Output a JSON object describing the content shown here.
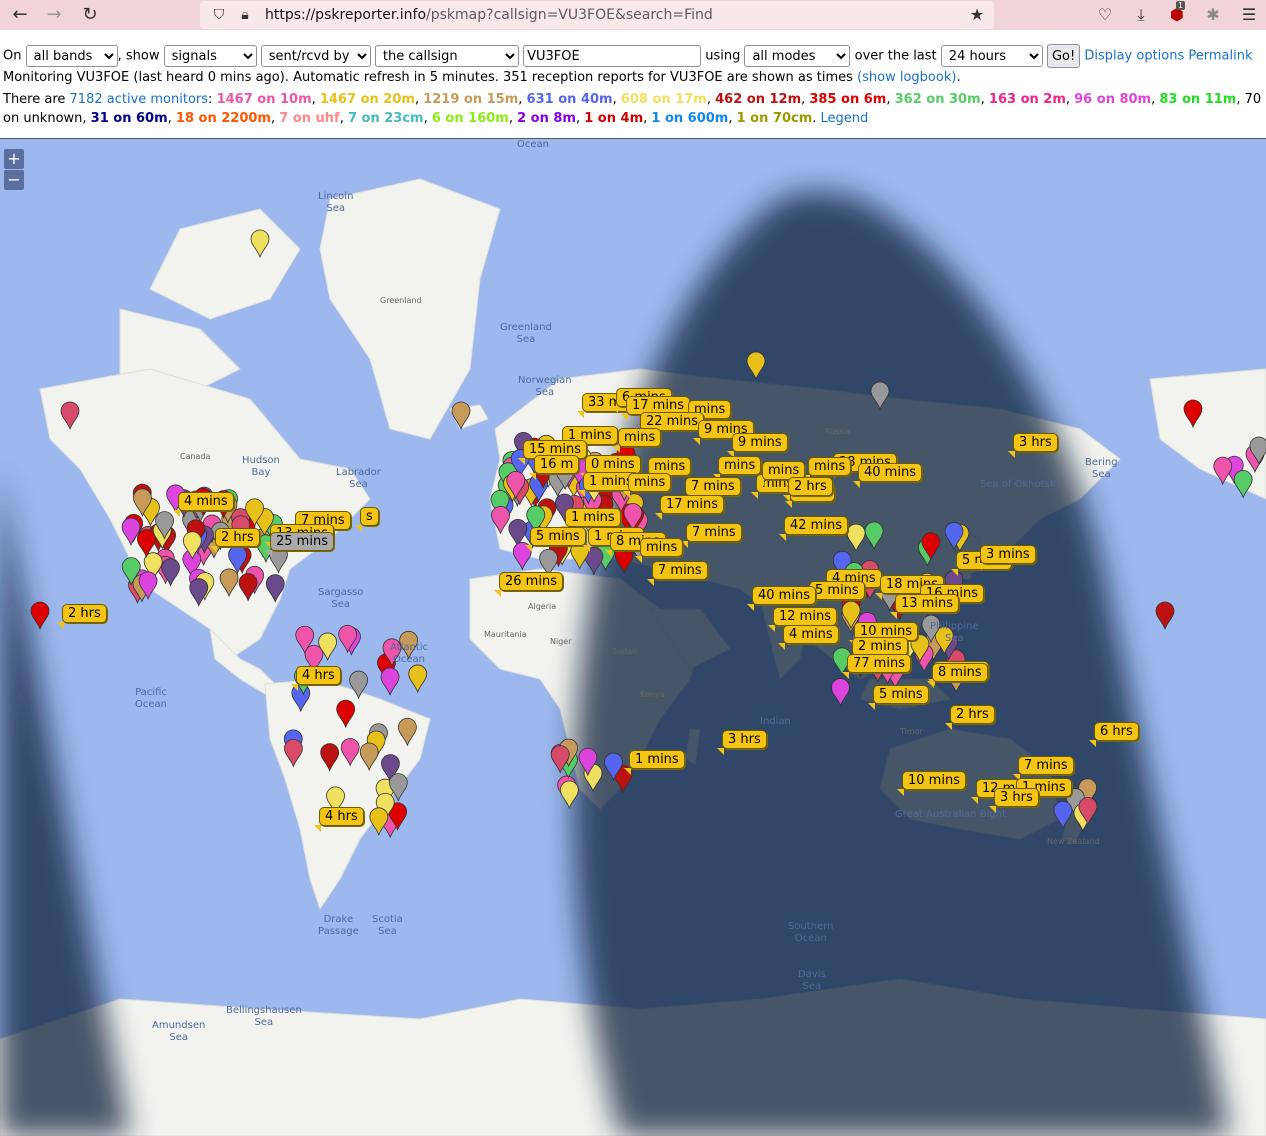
{
  "browser": {
    "url_domain": "https://pskreporter.info",
    "url_path": "/pskmap?callsign=VU3FOE&search=Find",
    "badge_count": "1"
  },
  "controls": {
    "on_label": "On",
    "band_select": "all bands",
    "show_label": ", show",
    "show_select": "signals",
    "direction_select": "sent/rcvd by",
    "target_select": "the callsign",
    "callsign_value": "VU3FOE",
    "using_label": "using",
    "mode_select": "all modes",
    "over_label": "over the last",
    "period_select": "24 hours",
    "go_button": "Go!",
    "display_options_link": "Display options",
    "permalink_link": "Permalink"
  },
  "status": {
    "monitoring_text": "Monitoring VU3FOE (last heard 0 mins ago). Automatic refresh in 5 minutes. 351 reception reports for VU3FOE are shown as times ",
    "logbook_link": "(show logbook)",
    "logbook_suffix": "."
  },
  "monitors": {
    "prefix": "There are ",
    "active_link": "7182 active monitors",
    "colon": ":",
    "bands": [
      {
        "text": "1467 on 10m",
        "color": "#ee55aa"
      },
      {
        "text": "1467 on 20m",
        "color": "#e8c01a"
      },
      {
        "text": "1219 on 15m",
        "color": "#c89a5a"
      },
      {
        "text": "631 on 40m",
        "color": "#5566ee"
      },
      {
        "text": "608 on 17m",
        "color": "#f0e060"
      },
      {
        "text": "462 on 12m",
        "color": "#bb1111"
      },
      {
        "text": "385 on 6m",
        "color": "#dd0000"
      },
      {
        "text": "362 on 30m",
        "color": "#55cc66"
      },
      {
        "text": "163 on 2m",
        "color": "#ee2288"
      },
      {
        "text": "96 on 80m",
        "color": "#dd44dd"
      },
      {
        "text": "83 on 11m",
        "color": "#22dd22"
      },
      {
        "text": "70 on unknown",
        "color": "#000000"
      },
      {
        "text": "31 on 60m",
        "color": "#000088"
      },
      {
        "text": "18 on 2200m",
        "color": "#ff5500"
      },
      {
        "text": "7 on uhf",
        "color": "#ff8888"
      },
      {
        "text": "7 on 23cm",
        "color": "#44bbbb"
      },
      {
        "text": "6 on 160m",
        "color": "#88ee11"
      },
      {
        "text": "2 on 8m",
        "color": "#8800dd"
      },
      {
        "text": "1 on 4m",
        "color": "#cc0000"
      },
      {
        "text": "1 on 600m",
        "color": "#1188ee"
      },
      {
        "text": "1 on 70cm",
        "color": "#999900"
      }
    ],
    "legend_link": "Legend"
  },
  "map": {
    "zoom_in": "+",
    "zoom_out": "−",
    "labels": {
      "ocean_top": "Ocean",
      "lincoln_sea": "Lincoln Sea",
      "greenland": "Greenland",
      "greenland_sea": "Greenland Sea",
      "norwegian_sea": "Norwegian Sea",
      "hudson_bay": "Hudson Bay",
      "labrador_sea": "Labrador Sea",
      "canada": "Canada",
      "sargasso_sea": "Sargasso Sea",
      "atlantic_ocean": "Atlantic Ocean",
      "pacific_ocean": "Pacific Ocean",
      "bering_sea": "Bering Sea",
      "sea_of_okhotsk": "Sea of Okhotsk",
      "philippine_sea": "Philippine Sea",
      "indian": "Indian",
      "great_australian_bight": "Great Australian Bight",
      "southern_ocean": "Southern Ocean",
      "davis_sea": "Davis Sea",
      "drake_passage": "Drake Passage",
      "scotia_sea": "Scotia Sea",
      "bellingshausen_sea": "Bellingshausen Sea",
      "amundsen_sea": "Amundsen Sea",
      "russia": "Russia",
      "algeria": "Algeria",
      "niger": "Niger",
      "sudan": "Sudan",
      "kenya": "Kenya",
      "mauritania": "Mauritania",
      "new_zealand": "New Zealand",
      "timor": "Timor"
    },
    "bubbles": [
      "33 mins",
      "6 mins",
      "17 mins",
      "mins",
      "22 mins",
      "9 mins",
      "1 mins",
      "mins",
      "9 mins",
      "15 mins",
      "16 m",
      "0 mins",
      "mins",
      "mins",
      "28 mins",
      "40 mins",
      "mins",
      "1 mins",
      "mins",
      "7 mins",
      "2 hrs",
      "mins",
      "mins",
      "3 hrs",
      "4 mins",
      "7 mins",
      "13 mins",
      "25 mins",
      "2 hrs",
      "1 mins",
      "17 mins",
      "5 mins",
      "1 mins",
      "42 mins",
      "7 mins",
      "8 mins",
      "mins",
      "26 mins",
      "7 mins",
      "5 mins",
      "3 mins",
      "4 mins",
      "5 mins",
      "18 mins",
      "40 mins",
      "16 mins",
      "13 mins",
      "12 mins",
      "10 mins",
      "4 mins",
      "2 mins",
      "8 mins",
      "77 mins",
      "8 mins",
      "5 mins",
      "2 hrs",
      "2 hrs",
      "2 hrs",
      "4 hrs",
      "3 hrs",
      "1 mins",
      "6 hrs",
      "7 mins",
      "10 mins",
      "12 m",
      "1 mins",
      "3 hrs",
      "4 hrs",
      "s"
    ]
  }
}
